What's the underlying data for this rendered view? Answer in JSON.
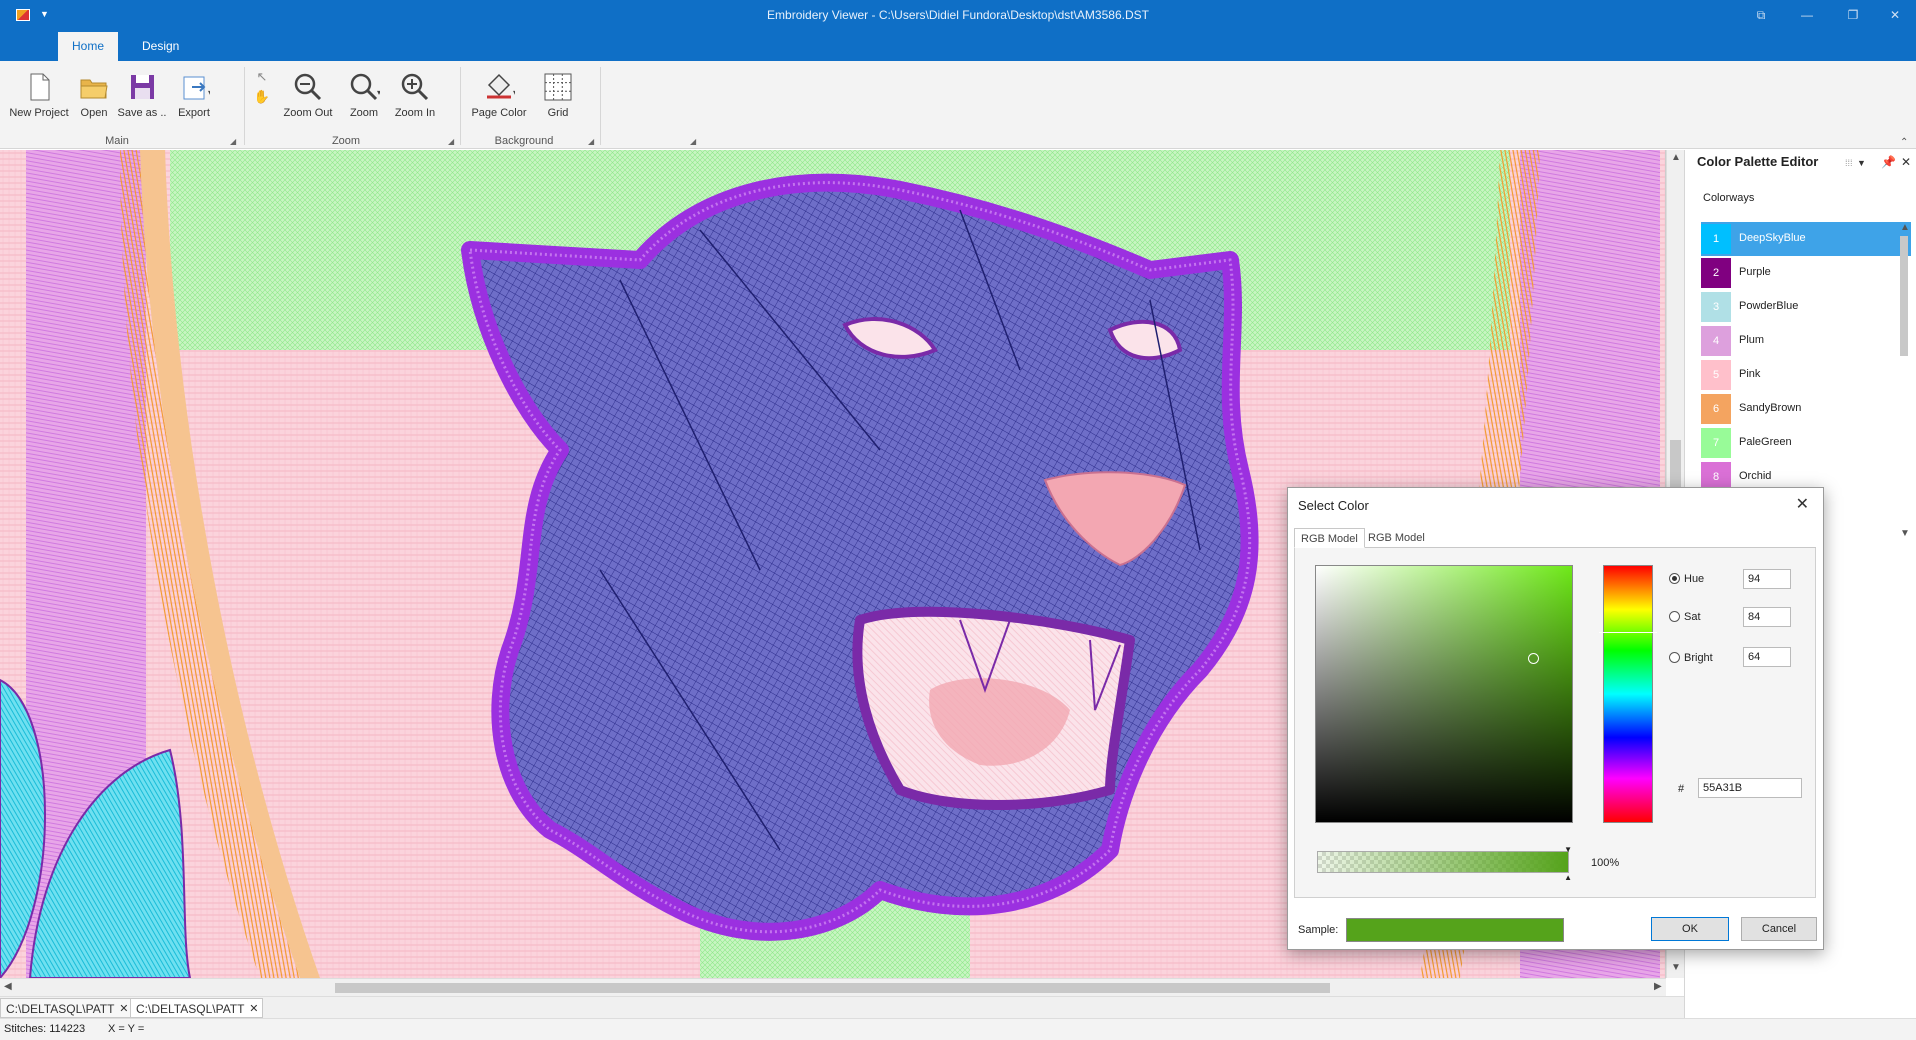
{
  "window": {
    "title": "Embroidery Viewer - C:\\Users\\Didiel Fundora\\Desktop\\dst\\AM3586.DST",
    "controls": [
      "⧉",
      "—",
      "❐",
      "✕"
    ]
  },
  "ribbon": {
    "tabs": [
      {
        "label": "Home",
        "active": true
      },
      {
        "label": "Design",
        "active": false
      }
    ],
    "groups": {
      "main": {
        "label": "Main",
        "buttons": {
          "new_project": "New Project",
          "open": "Open",
          "save_as": "Save as ..",
          "export": "Export"
        }
      },
      "zoom": {
        "label": "Zoom",
        "buttons": {
          "zoom_out": "Zoom Out",
          "zoom": "Zoom",
          "zoom_in": "Zoom In"
        }
      },
      "background": {
        "label": "Background",
        "buttons": {
          "page_color": "Page Color",
          "grid": "Grid"
        }
      }
    }
  },
  "document_tabs": [
    {
      "label": "C:\\DELTASQL\\PATT",
      "active": false
    },
    {
      "label": "C:\\DELTASQL\\PATT",
      "active": true
    }
  ],
  "status": {
    "stitches": "Stitches: 114223",
    "coords": "X = Y ="
  },
  "palette_panel": {
    "title": "Color Palette Editor",
    "section_label": "Colorways",
    "colorways": [
      {
        "index": "1",
        "name": "DeepSkyBlue",
        "color": "#00bfff",
        "selected": true
      },
      {
        "index": "2",
        "name": "Purple",
        "color": "#800080",
        "selected": false
      },
      {
        "index": "3",
        "name": "PowderBlue",
        "color": "#b0e0e6",
        "selected": false
      },
      {
        "index": "4",
        "name": "Plum",
        "color": "#dda0dd",
        "selected": false
      },
      {
        "index": "5",
        "name": "Pink",
        "color": "#ffc0cb",
        "selected": false
      },
      {
        "index": "6",
        "name": "SandyBrown",
        "color": "#f4a460",
        "selected": false
      },
      {
        "index": "7",
        "name": "PaleGreen",
        "color": "#98fb98",
        "selected": false
      },
      {
        "index": "8",
        "name": "Orchid",
        "color": "#da70d6",
        "selected": false
      }
    ]
  },
  "select_color_dialog": {
    "title": "Select Color",
    "tabs": [
      "RGB Model",
      "RGB Model"
    ],
    "hue_label": "Hue",
    "hue_value": "94",
    "sat_label": "Sat",
    "sat_value": "84",
    "bright_label": "Bright",
    "bright_value": "64",
    "selected_mode": "Hue",
    "hex_prefix": "#",
    "hex_value": "55A31B",
    "alpha_percent": "100%",
    "sample_label": "Sample:",
    "sample_color": "#55a31b",
    "ok_label": "OK",
    "cancel_label": "Cancel"
  },
  "colors": {
    "titlebar": "#0f6fc6",
    "selection": "#3ea3e8",
    "design_pink": "#fbd3dc",
    "design_purple": "#8a2be2",
    "design_navy": "#3b3b9a",
    "design_green": "#b8f2b0",
    "design_orange": "#f4a040"
  }
}
